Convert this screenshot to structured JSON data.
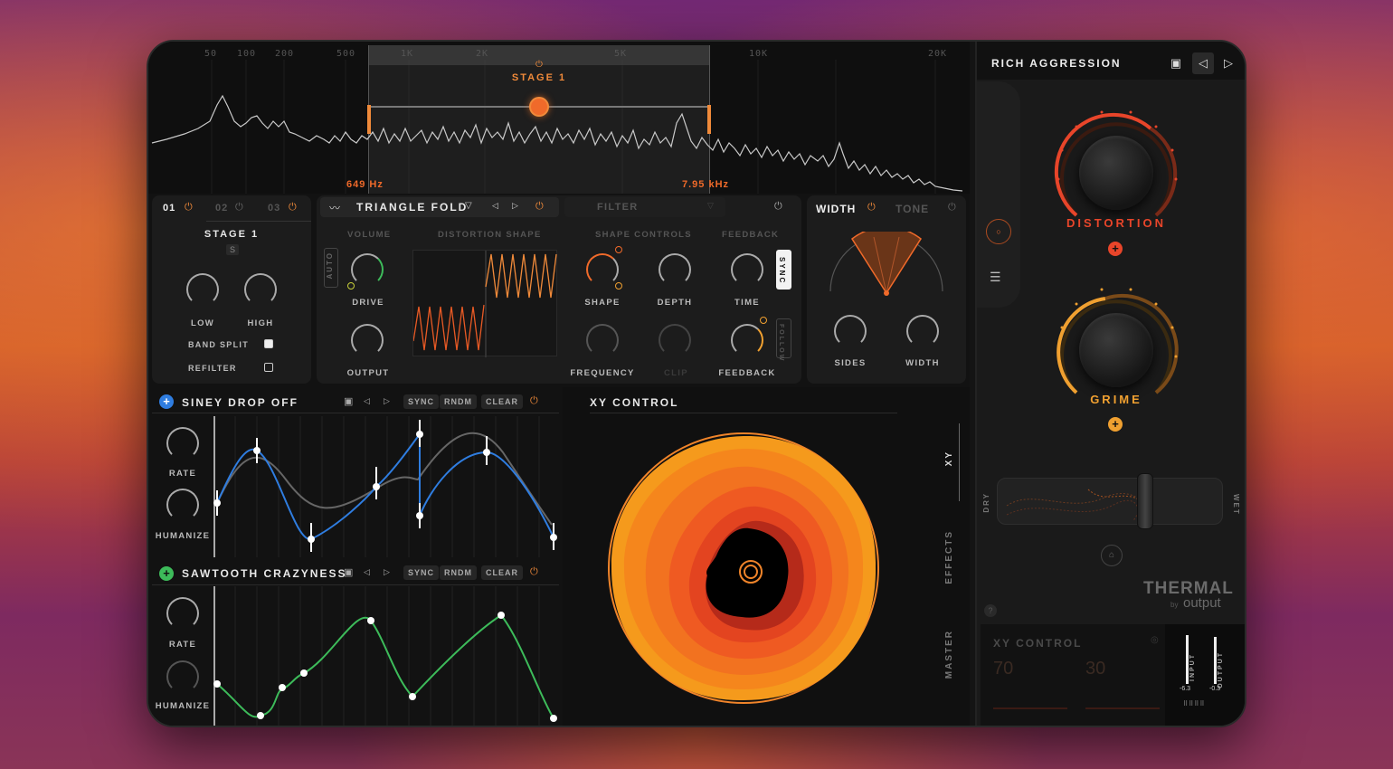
{
  "spectrum": {
    "freq_labels": [
      "50",
      "100",
      "200",
      "500",
      "1K",
      "2K",
      "5K",
      "10K",
      "20K"
    ],
    "stage_label": "STAGE 1",
    "low_hz": "649 Hz",
    "high_hz": "7.95 kHz"
  },
  "stage_panel": {
    "tabs": [
      "01",
      "02",
      "03"
    ],
    "title": "STAGE 1",
    "solo": "S",
    "knobs": [
      "LOW",
      "HIGH"
    ],
    "band_split": "BAND SPLIT",
    "band_split_on": true,
    "refilter": "REFILTER",
    "refilter_on": false
  },
  "distortion": {
    "type": "TRIANGLE FOLD",
    "filter": "FILTER",
    "headers": [
      "VOLUME",
      "DISTORTION SHAPE",
      "SHAPE CONTROLS",
      "FEEDBACK"
    ],
    "auto": "AUTO",
    "drive": "DRIVE",
    "output": "OUTPUT",
    "shape": "SHAPE",
    "depth": "DEPTH",
    "frequency": "FREQUENCY",
    "clip": "CLIP",
    "time": "TIME",
    "feedback": "FEEDBACK",
    "sync": "SYNC",
    "follow": "FOLLOW"
  },
  "width_panel": {
    "tabs": [
      "WIDTH",
      "TONE"
    ],
    "sides": "SIDES",
    "width": "WIDTH"
  },
  "lfo1": {
    "name": "SINEY DROP OFF",
    "accent": "#2f7de0",
    "buttons": [
      "SYNC",
      "RNDM",
      "CLEAR"
    ],
    "rate": "RATE",
    "humanize": "HUMANIZE"
  },
  "lfo2": {
    "name": "SAWTOOTH CRAZYNESS",
    "accent": "#3dbb5a",
    "buttons": [
      "SYNC",
      "RNDM",
      "CLEAR"
    ],
    "rate": "RATE",
    "humanize": "HUMANIZE"
  },
  "xy": {
    "title": "XY CONTROL",
    "side_tabs": [
      "XY",
      "EFFECTS",
      "MASTER"
    ]
  },
  "right": {
    "preset": "RICH AGGRESSION",
    "knob1": "DISTORTION",
    "knob1_color": "#e8452a",
    "knob2": "GRIME",
    "knob2_color": "#f0a030",
    "dry": "DRY",
    "wet": "WET",
    "brand": "THERMAL",
    "by": "by",
    "brand2": "output",
    "xy_title": "XY CONTROL",
    "val1": "70",
    "val2": "30",
    "input_label": "INPUT",
    "output_label": "OUTPUT",
    "input_val": "-6.3",
    "output_val": "-0.3"
  }
}
